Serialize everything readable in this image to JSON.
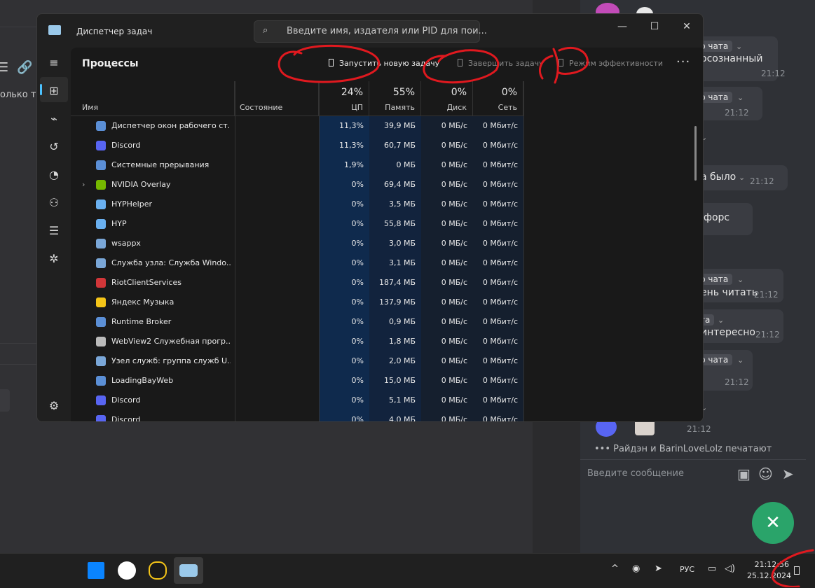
{
  "window": {
    "title": "Диспетчер задач",
    "search_placeholder": "Введите имя, издателя или PID для пои...",
    "controls": {
      "minimize": "—",
      "maximize": "☐",
      "close": "✕"
    }
  },
  "toolbar": {
    "title": "Процессы",
    "run_task": "Запустить новую задачу",
    "end_task": "Завершить задачу",
    "efficiency": "Режим эффективности",
    "more": "···"
  },
  "columns": {
    "name": "Имя",
    "status": "Состояние",
    "cpu": {
      "pct": "24%",
      "label": "ЦП"
    },
    "mem": {
      "pct": "55%",
      "label": "Память"
    },
    "disk": {
      "pct": "0%",
      "label": "Диск"
    },
    "net": {
      "pct": "0%",
      "label": "Сеть"
    }
  },
  "processes": [
    {
      "name": "Диспетчер окон рабочего ст...",
      "cpu": "11,3%",
      "mem": "39,9 МБ",
      "disk": "0 МБ/с",
      "net": "0 Мбит/с",
      "icon": "window-icon",
      "color": "#5b8fd6"
    },
    {
      "name": "Discord",
      "cpu": "11,3%",
      "mem": "60,7 МБ",
      "disk": "0 МБ/с",
      "net": "0 Мбит/с",
      "icon": "discord-icon",
      "color": "#5865f2"
    },
    {
      "name": "Системные прерывания",
      "cpu": "1,9%",
      "mem": "0 МБ",
      "disk": "0 МБ/с",
      "net": "0 Мбит/с",
      "icon": "window-icon",
      "color": "#5b8fd6"
    },
    {
      "name": "NVIDIA Overlay",
      "cpu": "0%",
      "mem": "69,4 МБ",
      "disk": "0 МБ/с",
      "net": "0 Мбит/с",
      "icon": "nvidia-icon",
      "color": "#76b900",
      "expander": "›"
    },
    {
      "name": "HYPHelper",
      "cpu": "0%",
      "mem": "3,5 МБ",
      "disk": "0 МБ/с",
      "net": "0 Мбит/с",
      "icon": "hyp-icon",
      "color": "#6ab0f0"
    },
    {
      "name": "HYP",
      "cpu": "0%",
      "mem": "55,8 МБ",
      "disk": "0 МБ/с",
      "net": "0 Мбит/с",
      "icon": "hyp-icon",
      "color": "#6ab0f0"
    },
    {
      "name": "wsappx",
      "cpu": "0%",
      "mem": "3,0 МБ",
      "disk": "0 МБ/с",
      "net": "0 Мбит/с",
      "icon": "gear-service-icon",
      "color": "#7aa7d8"
    },
    {
      "name": "Служба узла: Служба Windo...",
      "cpu": "0%",
      "mem": "3,1 МБ",
      "disk": "0 МБ/с",
      "net": "0 Мбит/с",
      "icon": "gear-service-icon",
      "color": "#7aa7d8"
    },
    {
      "name": "RiotClientServices",
      "cpu": "0%",
      "mem": "187,4 МБ",
      "disk": "0 МБ/с",
      "net": "0 Мбит/с",
      "icon": "riot-icon",
      "color": "#d13639"
    },
    {
      "name": "Яндекс Музыка",
      "cpu": "0%",
      "mem": "137,9 МБ",
      "disk": "0 МБ/с",
      "net": "0 Мбит/с",
      "icon": "yandex-music-icon",
      "color": "#f5c518"
    },
    {
      "name": "Runtime Broker",
      "cpu": "0%",
      "mem": "0,9 МБ",
      "disk": "0 МБ/с",
      "net": "0 Мбит/с",
      "icon": "window-icon",
      "color": "#5b8fd6"
    },
    {
      "name": "WebView2 Служебная прогр...",
      "cpu": "0%",
      "mem": "1,8 МБ",
      "disk": "0 МБ/с",
      "net": "0 Мбит/с",
      "icon": "briefcase-icon",
      "color": "#bbbbbb"
    },
    {
      "name": "Узел служб: группа служб U...",
      "cpu": "0%",
      "mem": "2,0 МБ",
      "disk": "0 МБ/с",
      "net": "0 Мбит/с",
      "icon": "gear-service-icon",
      "color": "#7aa7d8"
    },
    {
      "name": "LoadingBayWeb",
      "cpu": "0%",
      "mem": "15,0 МБ",
      "disk": "0 МБ/с",
      "net": "0 Мбит/с",
      "icon": "window-icon",
      "color": "#5b8fd6"
    },
    {
      "name": "Discord",
      "cpu": "0%",
      "mem": "5,1 МБ",
      "disk": "0 МБ/с",
      "net": "0 Мбит/с",
      "icon": "discord-icon",
      "color": "#5865f2"
    },
    {
      "name": "Discord",
      "cpu": "0%",
      "mem": "4,0 МБ",
      "disk": "0 МБ/с",
      "net": "0 Мбит/с",
      "icon": "discord-icon",
      "color": "#5865f2"
    }
  ],
  "chat": {
    "fragments": [
      {
        "text": "осознанный",
        "type": "msg"
      },
      {
        "text": "21:12",
        "type": "time"
      },
      {
        "text": "р чата",
        "type": "chip"
      },
      {
        "text": "21:12",
        "type": "time"
      },
      {
        "text": "а было",
        "type": "msg"
      },
      {
        "text": "21:12",
        "type": "time"
      },
      {
        "text": "форс",
        "type": "msg"
      },
      {
        "text": "р чата",
        "type": "chip"
      },
      {
        "text": "ень читать",
        "type": "msg"
      },
      {
        "text": "21:12",
        "type": "time"
      },
      {
        "text": "та",
        "type": "chip"
      },
      {
        "text": "интересно",
        "type": "msg"
      },
      {
        "text": "21:12",
        "type": "time"
      },
      {
        "text": "р чата",
        "type": "chip"
      },
      {
        "text": "21:12",
        "type": "time"
      },
      {
        "text": "21:12",
        "type": "time"
      },
      {
        "text": "та",
        "type": "chip"
      }
    ],
    "typing": "Райдэн и BarinLoveLolz печатают",
    "input_placeholder": "Введите сообщение",
    "fab": "✕"
  },
  "desktop_left": {
    "text": "олько те"
  },
  "taskbar": {
    "lang": "РУС",
    "time": "21:12:56",
    "date": "25.12.2024",
    "tray_up": "^"
  },
  "colors": {
    "accent": "#4cc2ff",
    "cpu_highlight": "#0f2a4d",
    "annotation": "#e0191f"
  }
}
